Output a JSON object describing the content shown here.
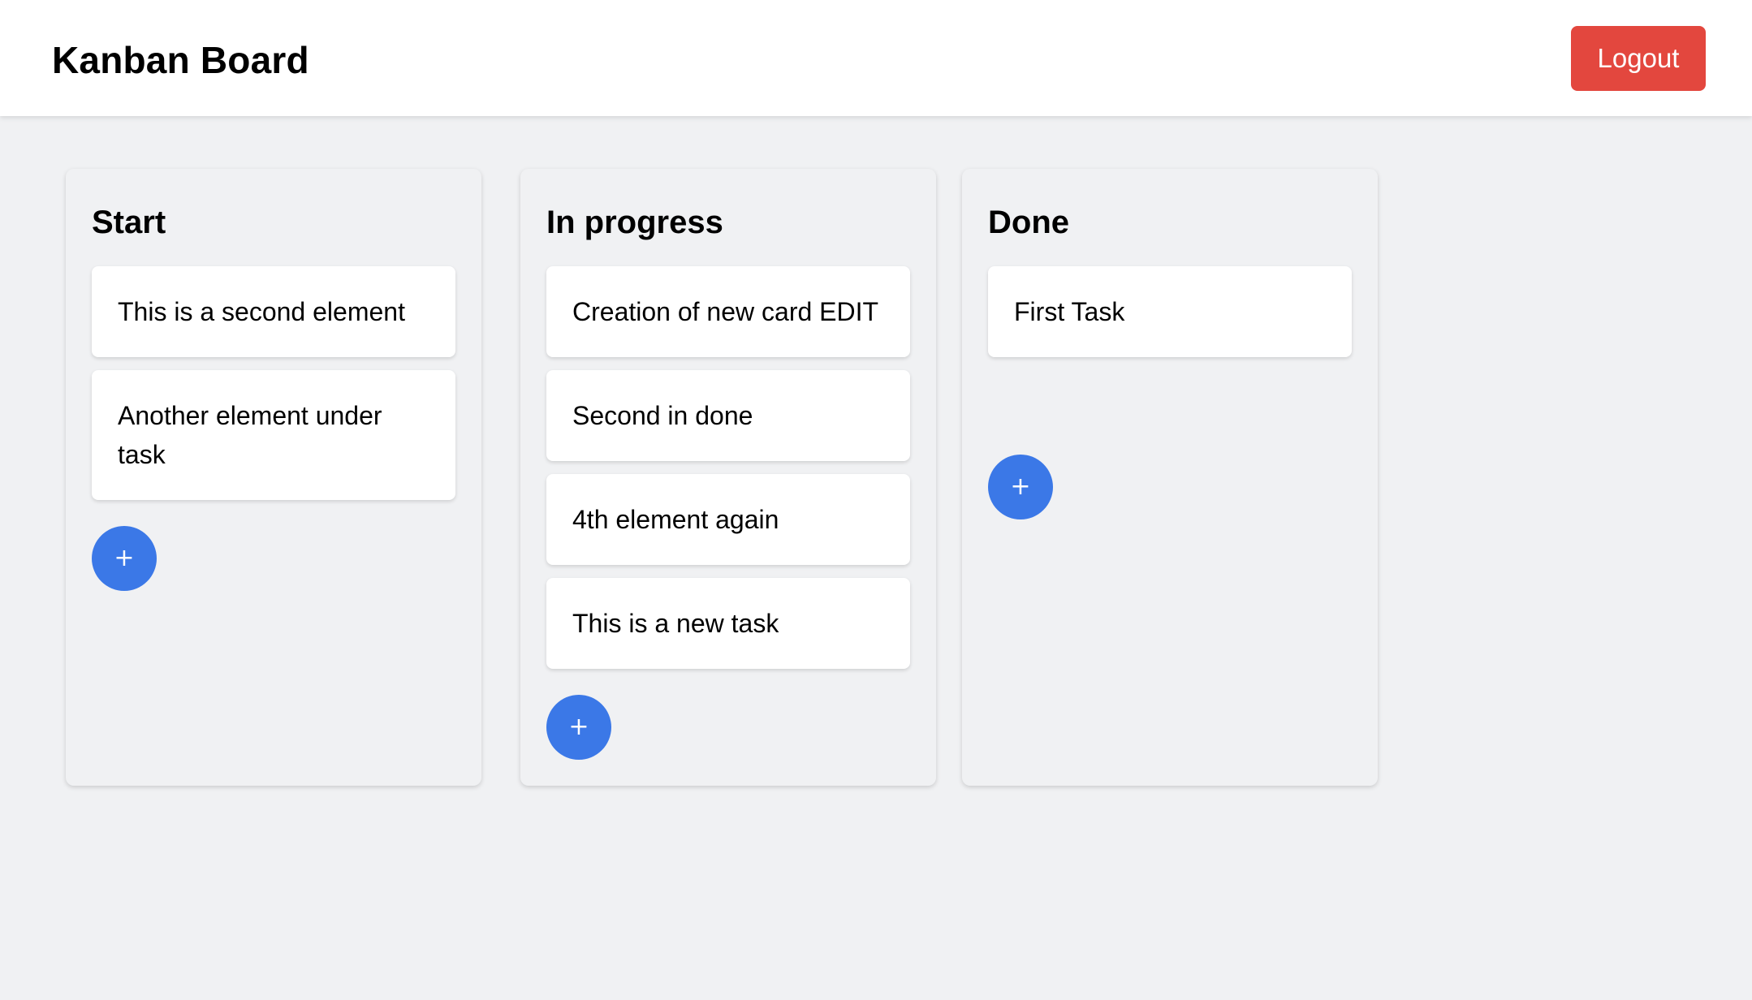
{
  "header": {
    "title": "Kanban Board",
    "logout_label": "Logout"
  },
  "colors": {
    "background": "#f0f1f3",
    "logout_button": "#e3473e",
    "add_button": "#3b78e7",
    "card": "#ffffff"
  },
  "columns": [
    {
      "title": "Start",
      "cards": [
        "This is a second element",
        "Another element under task"
      ],
      "add_label": "+"
    },
    {
      "title": "In progress",
      "cards": [
        "Creation of new card EDIT",
        "Second in done",
        "4th element again",
        "This is a new task"
      ],
      "add_label": "+"
    },
    {
      "title": "Done",
      "cards": [
        "First Task"
      ],
      "add_label": "+"
    }
  ]
}
